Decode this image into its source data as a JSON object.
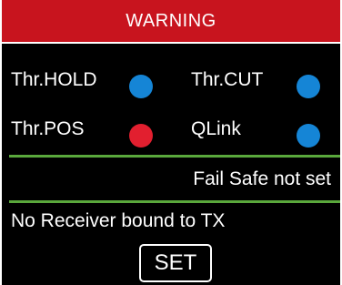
{
  "header": {
    "title": "WARNING"
  },
  "switches": [
    {
      "label": "Thr.HOLD",
      "status_color": "#1585d6"
    },
    {
      "label": "Thr.CUT",
      "status_color": "#1585d6"
    },
    {
      "label": "Thr.POS",
      "status_color": "#e21f2f"
    },
    {
      "label": "QLink",
      "status_color": "#1585d6"
    }
  ],
  "failsafe": {
    "message": "Fail Safe not set"
  },
  "receiver": {
    "message": "No Receiver bound to TX"
  },
  "actions": {
    "set_label": "SET"
  },
  "colors": {
    "title_bar": "#c8141e",
    "divider": "#5aa83c",
    "ok": "#1585d6",
    "alert": "#e21f2f"
  }
}
